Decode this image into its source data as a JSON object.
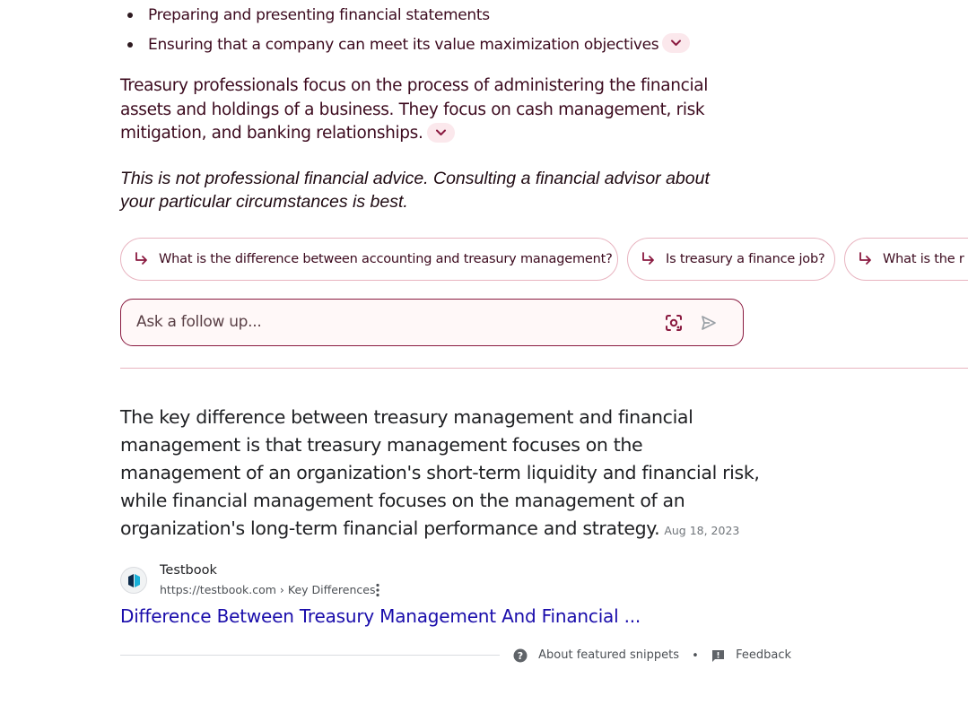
{
  "overview": {
    "bullets": [
      "Preparing and presenting financial statements",
      "Ensuring that a company can meet its value maximization objectives"
    ],
    "paragraph": "Treasury professionals focus on the process of administering the financial assets and holdings of a business. They focus on cash management, risk mitigation, and banking relationships.",
    "disclaimer": "This is not professional financial advice. Consulting a financial advisor about your particular circumstances is best."
  },
  "suggestions": [
    "What is the difference between accounting and treasury management?",
    "Is treasury a finance job?",
    "What is the r"
  ],
  "followup": {
    "placeholder": "Ask a follow up..."
  },
  "snippet": {
    "text": "The key difference between treasury management and financial management is that treasury management focuses on the management of an organization's short-term liquidity and financial risk, while financial management focuses on the management of an organization's long-term financial performance and strategy.",
    "date": "Aug 18, 2023",
    "source_name": "Testbook",
    "source_url": "https://testbook.com › Key Differences",
    "title": "Difference Between Treasury Management And Financial ..."
  },
  "footer": {
    "about": "About featured snippets",
    "separator": "•",
    "feedback": "Feedback"
  },
  "colors": {
    "accent": "#8a1a40",
    "chip_border": "#e8b4c0",
    "link": "#1a0dab",
    "pill_bg": "#fbe8ec"
  }
}
